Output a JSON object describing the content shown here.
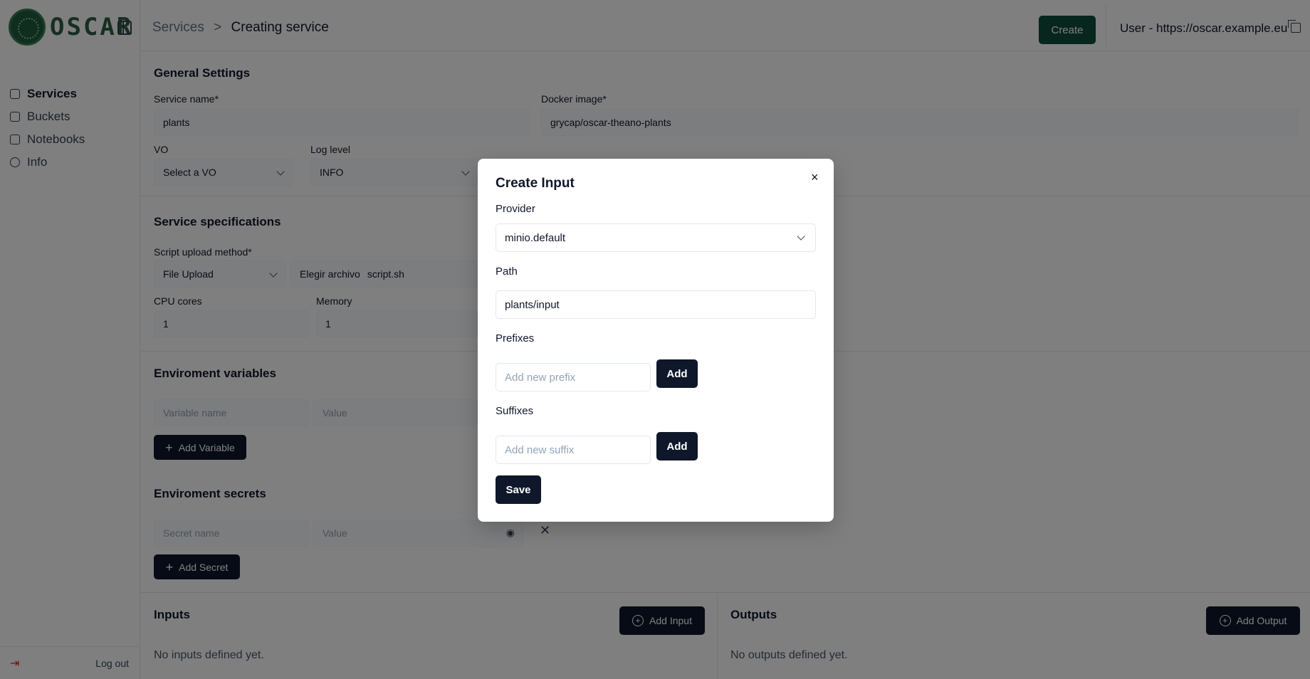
{
  "app": {
    "logo_text": "OSCAR"
  },
  "sidebar": {
    "items": [
      {
        "label": "Services",
        "active": true
      },
      {
        "label": "Buckets"
      },
      {
        "label": "Notebooks"
      },
      {
        "label": "Info"
      }
    ],
    "logout_label": "Log out"
  },
  "header": {
    "breadcrumb_parent": "Services",
    "breadcrumb_sep": ">",
    "breadcrumb_current": "Creating service",
    "create_label": "Create",
    "user": "User - https://oscar.example.eu"
  },
  "general": {
    "title": "General Settings",
    "service_name_label": "Service name*",
    "service_name_value": "plants",
    "docker_image_label": "Docker image*",
    "docker_image_value": "grycap/oscar-theano-plants",
    "vo_label": "VO",
    "vo_value": "Select a VO",
    "log_level_label": "Log level",
    "log_level_value": "INFO"
  },
  "specs": {
    "title": "Service specifications",
    "script_label": "Script upload method*",
    "script_method": "File Upload",
    "file_button": "Elegir archivo",
    "file_name": "script.sh",
    "cpu_label": "CPU cores",
    "cpu_value": "1",
    "memory_label": "Memory",
    "memory_value": "1"
  },
  "env": {
    "title": "Enviroment variables",
    "name_placeholder": "Variable name",
    "value_placeholder": "Value",
    "add_label": "Add Variable"
  },
  "secrets": {
    "title": "Enviroment secrets",
    "name_placeholder": "Secret name",
    "value_placeholder": "Value",
    "add_label": "Add Secret"
  },
  "inputs": {
    "title": "Inputs",
    "add_label": "Add Input",
    "empty": "No inputs defined yet."
  },
  "outputs": {
    "title": "Outputs",
    "add_label": "Add Output",
    "empty": "No outputs defined yet."
  },
  "modal": {
    "title": "Create Input",
    "close": "×",
    "provider_label": "Provider",
    "provider_value": "minio.default",
    "path_label": "Path",
    "path_value": "plants/input",
    "prefixes_label": "Prefixes",
    "prefix_placeholder": "Add new prefix",
    "suffixes_label": "Suffixes",
    "suffix_placeholder": "Add new suffix",
    "add_label": "Add",
    "save_label": "Save"
  }
}
